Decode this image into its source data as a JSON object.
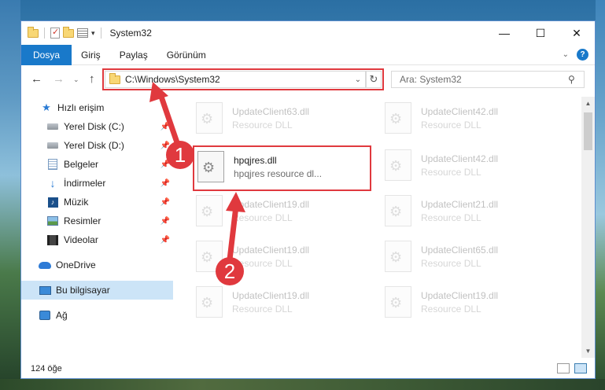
{
  "window": {
    "title": "System32",
    "controls": {
      "minimize": "—",
      "maximize": "☐",
      "close": "✕"
    }
  },
  "ribbon": {
    "tabs": [
      "Dosya",
      "Giriş",
      "Paylaş",
      "Görünüm"
    ],
    "help": "?"
  },
  "address": {
    "path": "C:\\Windows\\System32",
    "search_placeholder": "Ara: System32"
  },
  "sidebar": {
    "quick_access": "Hızlı erişim",
    "items": [
      {
        "label": "Yerel Disk (C:)",
        "icon": "drive-icon",
        "pinned": true
      },
      {
        "label": "Yerel Disk (D:)",
        "icon": "drive-icon",
        "pinned": true
      },
      {
        "label": "Belgeler",
        "icon": "documents-icon",
        "pinned": true
      },
      {
        "label": "İndirmeler",
        "icon": "download-icon",
        "pinned": true
      },
      {
        "label": "Müzik",
        "icon": "music-icon",
        "pinned": true
      },
      {
        "label": "Resimler",
        "icon": "pictures-icon",
        "pinned": true
      },
      {
        "label": "Videolar",
        "icon": "videos-icon",
        "pinned": true
      }
    ],
    "onedrive": "OneDrive",
    "this_pc": "Bu bilgisayar",
    "network": "Ağ"
  },
  "files": {
    "highlighted": {
      "name": "hpqjres.dll",
      "desc": "hpqjres resource dl..."
    },
    "left_column": [
      {
        "name": "UpdateClient63.dll",
        "desc": "Resource DLL"
      },
      {
        "name": "UpdateClient19.dll",
        "desc": "Resource DLL"
      },
      {
        "name": "UpdateClient19.dll",
        "desc": "Resource DLL"
      },
      {
        "name": "UpdateClient19.dll",
        "desc": "Resource DLL"
      }
    ],
    "right_column": [
      {
        "name": "UpdateClient42.dll",
        "desc": "Resource DLL"
      },
      {
        "name": "UpdateClient42.dll",
        "desc": "Resource DLL"
      },
      {
        "name": "UpdateClient21.dll",
        "desc": "Resource DLL"
      },
      {
        "name": "UpdateClient65.dll",
        "desc": "Resource DLL"
      },
      {
        "name": "UpdateClient19.dll",
        "desc": "Resource DLL"
      }
    ]
  },
  "status": {
    "count": "124 öğe"
  },
  "annotations": {
    "step1": "1",
    "step2": "2",
    "color": "#e0393e"
  }
}
